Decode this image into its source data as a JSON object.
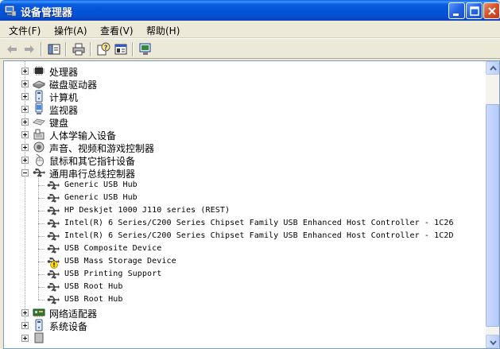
{
  "window": {
    "title": "设备管理器"
  },
  "menu": [
    {
      "label": "文件(F)"
    },
    {
      "label": "操作(A)"
    },
    {
      "label": "查看(V)"
    },
    {
      "label": "帮助(H)"
    }
  ],
  "toolbar_icons": [
    "back-icon",
    "forward-icon",
    "show-hide-console-tree-icon",
    "print-icon",
    "help-icon",
    "properties-icon",
    "scan-hardware-icon"
  ],
  "tree": {
    "categories_top": [
      {
        "label": "处理器",
        "icon": "processor-icon"
      },
      {
        "label": "磁盘驱动器",
        "icon": "disk-drive-icon"
      },
      {
        "label": "计算机",
        "icon": "computer-icon"
      },
      {
        "label": "监视器",
        "icon": "monitor-icon"
      },
      {
        "label": "键盘",
        "icon": "keyboard-icon"
      },
      {
        "label": "人体学输入设备",
        "icon": "hid-icon"
      },
      {
        "label": "声音、视频和游戏控制器",
        "icon": "sound-icon"
      },
      {
        "label": "鼠标和其它指针设备",
        "icon": "mouse-icon"
      }
    ],
    "usb_category": {
      "label": "通用串行总线控制器",
      "icon": "usb-icon"
    },
    "usb_devices": [
      {
        "label": "Generic USB Hub",
        "warning": false
      },
      {
        "label": "Generic USB Hub",
        "warning": false
      },
      {
        "label": "HP Deskjet 1000 J110 series (REST)",
        "warning": false
      },
      {
        "label": "Intel(R) 6 Series/C200 Series Chipset Family USB Enhanced Host Controller - 1C26",
        "warning": false
      },
      {
        "label": "Intel(R) 6 Series/C200 Series Chipset Family USB Enhanced Host Controller - 1C2D",
        "warning": false
      },
      {
        "label": "USB Composite Device",
        "warning": false
      },
      {
        "label": "USB Mass Storage Device",
        "warning": true
      },
      {
        "label": "USB Printing Support",
        "warning": false
      },
      {
        "label": "USB Root Hub",
        "warning": false
      },
      {
        "label": "USB Root Hub",
        "warning": false
      }
    ],
    "categories_bottom": [
      {
        "label": "网络适配器",
        "icon": "network-adapter-icon"
      },
      {
        "label": "系统设备",
        "icon": "system-device-icon"
      }
    ]
  },
  "colors": {
    "titlebar": "#0554d8",
    "warning": "#ffd800",
    "pane_border": "#7f9db9"
  }
}
